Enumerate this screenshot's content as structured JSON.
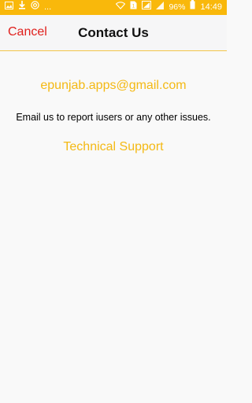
{
  "status_bar": {
    "left_icons": [
      "image-icon",
      "download-icon",
      "at-icon"
    ],
    "more_indicator": "...",
    "battery": "96%",
    "time": "14:49",
    "background_color": "#f9b80b"
  },
  "nav": {
    "cancel_label": "Cancel",
    "title": "Contact Us",
    "cancel_color": "#e0201d"
  },
  "content": {
    "email": "epunjab.apps@gmail.com",
    "info": "Email us to report iusers or any other issues.",
    "support_link": "Technical Support",
    "link_color": "#f4b914"
  }
}
